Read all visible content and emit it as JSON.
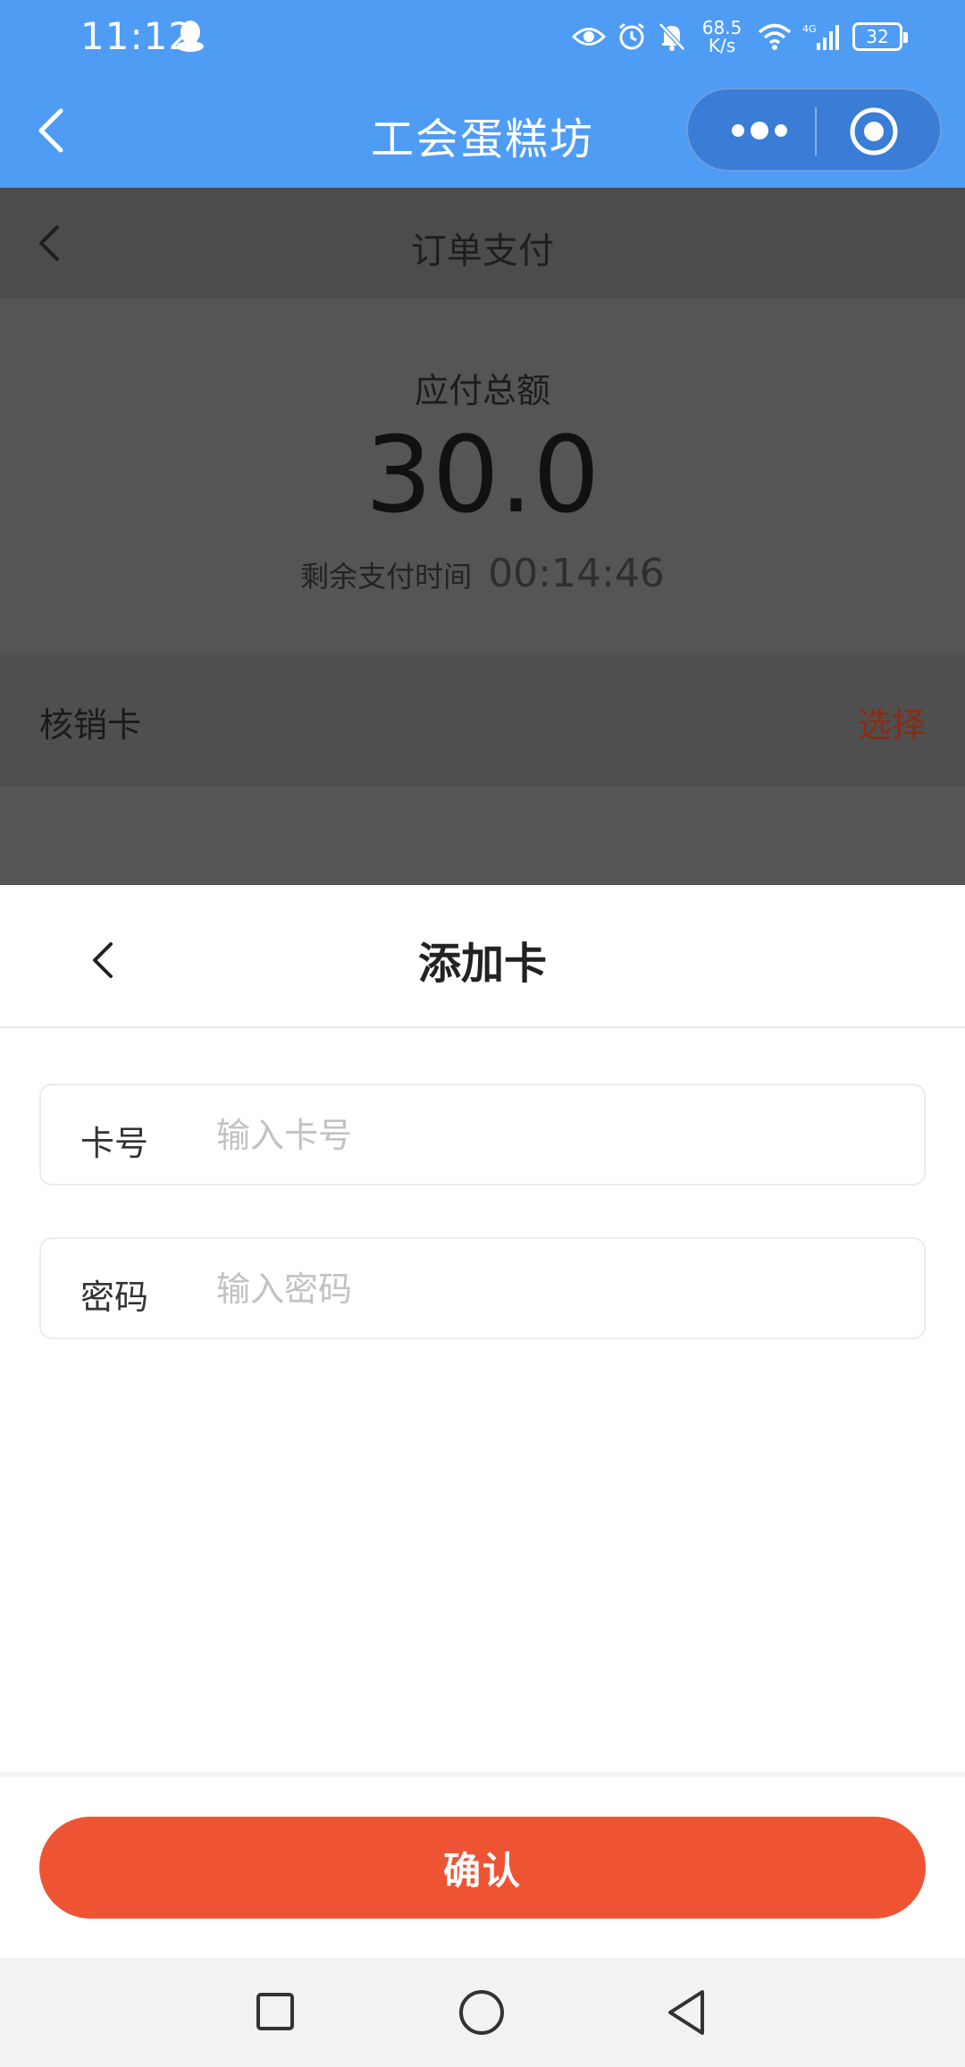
{
  "status_bar": {
    "time": "11:12",
    "net_speed_value": "68.5",
    "net_speed_unit": "K/s",
    "battery": "32",
    "icons": [
      "qq-icon",
      "eye-icon",
      "alarm-icon",
      "bell-off-icon",
      "wifi-icon",
      "signal-4g-icon",
      "battery-icon"
    ]
  },
  "nav": {
    "title": "工会蛋糕坊",
    "back_icon": "chevron-left-icon",
    "capsule_icons": [
      "more-dots-icon",
      "close-target-icon"
    ]
  },
  "page": {
    "title": "订单支付",
    "amount_label": "应付总额",
    "amount_value": "30.0",
    "remaining_label": "剩余支付时间",
    "remaining_time": "00:14:46",
    "card_row_label": "核销卡",
    "card_row_action": "选择"
  },
  "sheet": {
    "title": "添加卡",
    "card_field": {
      "label": "卡号",
      "value": "",
      "placeholder": "输入卡号"
    },
    "password_field": {
      "label": "密码",
      "value": "",
      "placeholder": "输入密码"
    },
    "confirm_label": "确认"
  },
  "system_nav": {
    "icons": [
      "recent-apps-square-icon",
      "home-circle-icon",
      "back-triangle-icon"
    ]
  },
  "colors": {
    "nav_blue": "#4f9cf5",
    "accent": "#ee5434",
    "overlay": "#555555"
  }
}
